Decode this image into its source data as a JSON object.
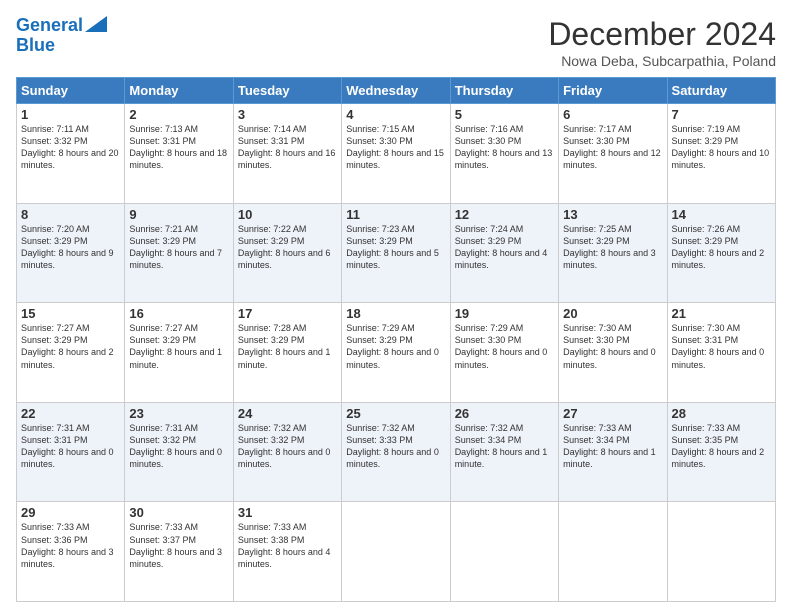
{
  "logo": {
    "line1": "General",
    "line2": "Blue"
  },
  "title": "December 2024",
  "subtitle": "Nowa Deba, Subcarpathia, Poland",
  "days_of_week": [
    "Sunday",
    "Monday",
    "Tuesday",
    "Wednesday",
    "Thursday",
    "Friday",
    "Saturday"
  ],
  "weeks": [
    [
      {
        "day": "1",
        "sunrise": "7:11 AM",
        "sunset": "3:32 PM",
        "daylight": "8 hours and 20 minutes."
      },
      {
        "day": "2",
        "sunrise": "7:13 AM",
        "sunset": "3:31 PM",
        "daylight": "8 hours and 18 minutes."
      },
      {
        "day": "3",
        "sunrise": "7:14 AM",
        "sunset": "3:31 PM",
        "daylight": "8 hours and 16 minutes."
      },
      {
        "day": "4",
        "sunrise": "7:15 AM",
        "sunset": "3:30 PM",
        "daylight": "8 hours and 15 minutes."
      },
      {
        "day": "5",
        "sunrise": "7:16 AM",
        "sunset": "3:30 PM",
        "daylight": "8 hours and 13 minutes."
      },
      {
        "day": "6",
        "sunrise": "7:17 AM",
        "sunset": "3:30 PM",
        "daylight": "8 hours and 12 minutes."
      },
      {
        "day": "7",
        "sunrise": "7:19 AM",
        "sunset": "3:29 PM",
        "daylight": "8 hours and 10 minutes."
      }
    ],
    [
      {
        "day": "8",
        "sunrise": "7:20 AM",
        "sunset": "3:29 PM",
        "daylight": "8 hours and 9 minutes."
      },
      {
        "day": "9",
        "sunrise": "7:21 AM",
        "sunset": "3:29 PM",
        "daylight": "8 hours and 7 minutes."
      },
      {
        "day": "10",
        "sunrise": "7:22 AM",
        "sunset": "3:29 PM",
        "daylight": "8 hours and 6 minutes."
      },
      {
        "day": "11",
        "sunrise": "7:23 AM",
        "sunset": "3:29 PM",
        "daylight": "8 hours and 5 minutes."
      },
      {
        "day": "12",
        "sunrise": "7:24 AM",
        "sunset": "3:29 PM",
        "daylight": "8 hours and 4 minutes."
      },
      {
        "day": "13",
        "sunrise": "7:25 AM",
        "sunset": "3:29 PM",
        "daylight": "8 hours and 3 minutes."
      },
      {
        "day": "14",
        "sunrise": "7:26 AM",
        "sunset": "3:29 PM",
        "daylight": "8 hours and 2 minutes."
      }
    ],
    [
      {
        "day": "15",
        "sunrise": "7:27 AM",
        "sunset": "3:29 PM",
        "daylight": "8 hours and 2 minutes."
      },
      {
        "day": "16",
        "sunrise": "7:27 AM",
        "sunset": "3:29 PM",
        "daylight": "8 hours and 1 minute."
      },
      {
        "day": "17",
        "sunrise": "7:28 AM",
        "sunset": "3:29 PM",
        "daylight": "8 hours and 1 minute."
      },
      {
        "day": "18",
        "sunrise": "7:29 AM",
        "sunset": "3:29 PM",
        "daylight": "8 hours and 0 minutes."
      },
      {
        "day": "19",
        "sunrise": "7:29 AM",
        "sunset": "3:30 PM",
        "daylight": "8 hours and 0 minutes."
      },
      {
        "day": "20",
        "sunrise": "7:30 AM",
        "sunset": "3:30 PM",
        "daylight": "8 hours and 0 minutes."
      },
      {
        "day": "21",
        "sunrise": "7:30 AM",
        "sunset": "3:31 PM",
        "daylight": "8 hours and 0 minutes."
      }
    ],
    [
      {
        "day": "22",
        "sunrise": "7:31 AM",
        "sunset": "3:31 PM",
        "daylight": "8 hours and 0 minutes."
      },
      {
        "day": "23",
        "sunrise": "7:31 AM",
        "sunset": "3:32 PM",
        "daylight": "8 hours and 0 minutes."
      },
      {
        "day": "24",
        "sunrise": "7:32 AM",
        "sunset": "3:32 PM",
        "daylight": "8 hours and 0 minutes."
      },
      {
        "day": "25",
        "sunrise": "7:32 AM",
        "sunset": "3:33 PM",
        "daylight": "8 hours and 0 minutes."
      },
      {
        "day": "26",
        "sunrise": "7:32 AM",
        "sunset": "3:34 PM",
        "daylight": "8 hours and 1 minute."
      },
      {
        "day": "27",
        "sunrise": "7:33 AM",
        "sunset": "3:34 PM",
        "daylight": "8 hours and 1 minute."
      },
      {
        "day": "28",
        "sunrise": "7:33 AM",
        "sunset": "3:35 PM",
        "daylight": "8 hours and 2 minutes."
      }
    ],
    [
      {
        "day": "29",
        "sunrise": "7:33 AM",
        "sunset": "3:36 PM",
        "daylight": "8 hours and 3 minutes."
      },
      {
        "day": "30",
        "sunrise": "7:33 AM",
        "sunset": "3:37 PM",
        "daylight": "8 hours and 3 minutes."
      },
      {
        "day": "31",
        "sunrise": "7:33 AM",
        "sunset": "3:38 PM",
        "daylight": "8 hours and 4 minutes."
      },
      null,
      null,
      null,
      null
    ]
  ]
}
